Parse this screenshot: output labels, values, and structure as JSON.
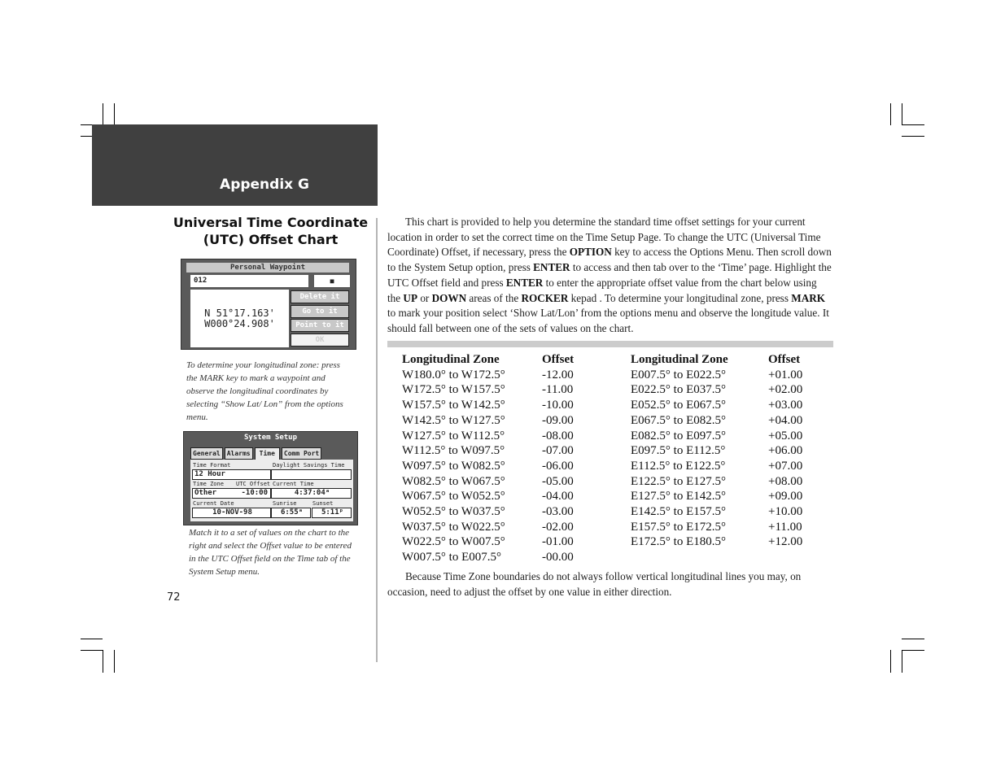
{
  "header": {
    "title": "Appendix G"
  },
  "section": {
    "title_line1": "Universal Time Coordinate",
    "title_line2": "(UTC) Offset Chart"
  },
  "waypoint_screen": {
    "title": "Personal Waypoint",
    "name": "012",
    "symbol": "■",
    "lat": "N 51°17.163'",
    "lon": "W000°24.908'",
    "buttons": [
      "Delete it",
      "Go to it",
      "Point to it",
      "OK"
    ]
  },
  "caption1": "To determine your longitudinal zone: press the MARK key to mark a waypoint and observe the longitudinal coordinates by selecting “Show Lat/ Lon” from the options menu.",
  "system_setup_screen": {
    "title": "System Setup",
    "tabs": [
      "General",
      "Alarms",
      "Time",
      "Comm Port"
    ],
    "active_tab": "Time",
    "labels": {
      "time_format": "Time Format",
      "dst": "Daylight Savings Time",
      "time_zone": "Time Zone",
      "utc_offset": "UTC Offset",
      "current_time": "Current Time",
      "current_date": "Current Date",
      "sunrise": "Sunrise",
      "sunset": "Sunset"
    },
    "values": {
      "time_format": "12 Hour",
      "dst": "",
      "time_zone": "Other",
      "utc_offset": "-10:00",
      "current_time": "4:37:04ᵃ",
      "current_date": "10-NOV-98",
      "sunrise": "6:55ᵃ",
      "sunset": "5:11ᵖ"
    }
  },
  "caption2": "Match it to a set of values on the chart to the right and select the Offset value to be entered in the UTC Offset field on the Time tab of the System Setup menu.",
  "page_number": "72",
  "intro": {
    "p1": "This chart is provided to help you determine the standard time offset settings for your current location in order to set the correct time on the Time Setup Page. To change the UTC (Universal Time Coordinate) Offset, if necessary, press the ",
    "k1": "OPTION",
    "p2": " key to access the Options Menu. Then scroll down to the System Setup option, press ",
    "k2": "ENTER",
    "p3": " to access and then tab over to the ‘Time’ page. Highlight the UTC Offset field and press ",
    "k3": "ENTER",
    "p4": " to enter the appropriate offset value from the chart below using the ",
    "k4": "UP",
    "p5": " or ",
    "k5": "DOWN",
    "p6": " areas of the  ",
    "k6": "ROCKER",
    "p7": " kepad . To determine your longitudinal zone, press ",
    "k7": "MARK",
    "p8": " to mark your position select ‘Show Lat/Lon’ from the options menu and observe the longitude value. It should fall between one of the sets of values on the chart."
  },
  "table": {
    "headers": {
      "zone": "Longitudinal Zone",
      "offset": "Offset"
    },
    "west": [
      {
        "zone": "W180.0° to W172.5°",
        "offset": "-12.00"
      },
      {
        "zone": "W172.5° to W157.5°",
        "offset": "-11.00"
      },
      {
        "zone": "W157.5° to W142.5°",
        "offset": "-10.00"
      },
      {
        "zone": "W142.5° to W127.5°",
        "offset": "-09.00"
      },
      {
        "zone": "W127.5° to W112.5°",
        "offset": "-08.00"
      },
      {
        "zone": "W112.5° to W097.5°",
        "offset": "-07.00"
      },
      {
        "zone": "W097.5° to W082.5°",
        "offset": "-06.00"
      },
      {
        "zone": "W082.5° to W067.5°",
        "offset": "-05.00"
      },
      {
        "zone": "W067.5° to W052.5°",
        "offset": "-04.00"
      },
      {
        "zone": "W052.5° to W037.5°",
        "offset": "-03.00"
      },
      {
        "zone": "W037.5° to W022.5°",
        "offset": "-02.00"
      },
      {
        "zone": "W022.5° to W007.5°",
        "offset": "-01.00"
      },
      {
        "zone": "W007.5° to E007.5°",
        "offset": "-00.00"
      }
    ],
    "east": [
      {
        "zone": "E007.5° to E022.5°",
        "offset": "+01.00"
      },
      {
        "zone": "E022.5° to E037.5°",
        "offset": "+02.00"
      },
      {
        "zone": "E052.5° to E067.5°",
        "offset": "+03.00"
      },
      {
        "zone": "E067.5° to E082.5°",
        "offset": "+04.00"
      },
      {
        "zone": "E082.5° to E097.5°",
        "offset": "+05.00"
      },
      {
        "zone": "E097.5° to E112.5°",
        "offset": "+06.00"
      },
      {
        "zone": "E112.5° to E122.5°",
        "offset": "+07.00"
      },
      {
        "zone": "E122.5° to E127.5°",
        "offset": "+08.00"
      },
      {
        "zone": "E127.5° to E142.5°",
        "offset": "+09.00"
      },
      {
        "zone": "E142.5° to E157.5°",
        "offset": "+10.00"
      },
      {
        "zone": "E157.5° to E172.5°",
        "offset": "+11.00"
      },
      {
        "zone": "E172.5° to E180.5°",
        "offset": "+12.00"
      }
    ]
  },
  "outro": "Because Time Zone boundaries do not always follow vertical longitudinal lines you may, on occasion, need to adjust the offset by one value in either direction."
}
